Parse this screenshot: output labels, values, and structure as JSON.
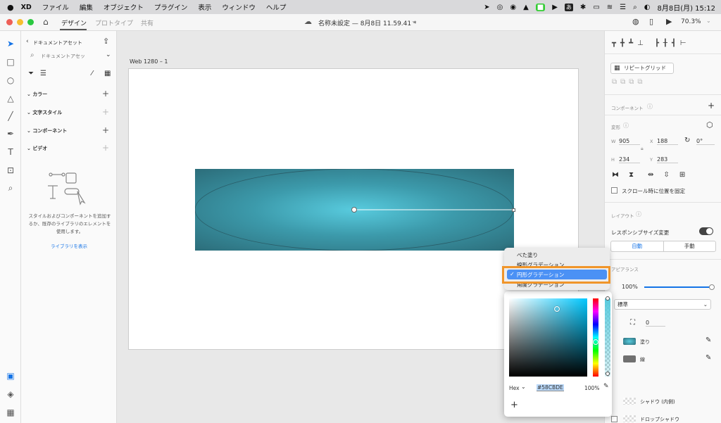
{
  "menubar": {
    "apple": "",
    "app": "XD",
    "items": [
      "ファイル",
      "編集",
      "オブジェクト",
      "プラグイン",
      "表示",
      "ウィンドウ",
      "ヘルプ"
    ],
    "ime": "あ",
    "clock": "8月8日(月) 15:12"
  },
  "titlebar": {
    "tabs": [
      "デザイン",
      "プロトタイプ",
      "共有"
    ],
    "doc_title": "名称未設定 — 8月8日 11.59.41 *",
    "zoom": "70.3%"
  },
  "assets": {
    "back_label": "ドキュメントアセット",
    "search_placeholder": "ドキュメントアセッ",
    "sections": [
      "カラー",
      "文字スタイル",
      "コンポーネント",
      "ビデオ"
    ],
    "empty_text": "スタイルおよびコンポーネントを追加するか、既存のライブラリのエレメントを使用します。",
    "library_link": "ライブラリを表示"
  },
  "canvas": {
    "artboard_name": "Web 1280 – 1"
  },
  "fill_menu": {
    "items": [
      "べた塗り",
      "線形グラデーション",
      "円形グラデーション",
      "角度グラデーション"
    ],
    "selected_check": "✓"
  },
  "color_picker": {
    "mode": "Hex",
    "hex": "#58CBDE",
    "opacity": "100%",
    "add": "+",
    "gradient_color": "#58cbde"
  },
  "props": {
    "repeat_grid": "リピートグリッド",
    "component_label": "コンポーネント",
    "transform_label": "変形",
    "w_label": "W",
    "w": "905",
    "x_label": "X",
    "x": "188",
    "rotation": "0°",
    "h_label": "H",
    "h": "234",
    "y_label": "Y",
    "y": "283",
    "fix_scroll": "スクロール時に位置を固定",
    "layout_label": "レイアウト",
    "responsive": "レスポンシブサイズ変更",
    "auto": "自動",
    "manual": "手動",
    "appearance_label": "アピアランス",
    "opacity": "100%",
    "blend": "標準",
    "corner": "0",
    "fill_label": "塗り",
    "stroke_label": "線",
    "inner_shadow": "シャドウ (内側)",
    "drop_shadow": "ドロップシャドウ"
  }
}
